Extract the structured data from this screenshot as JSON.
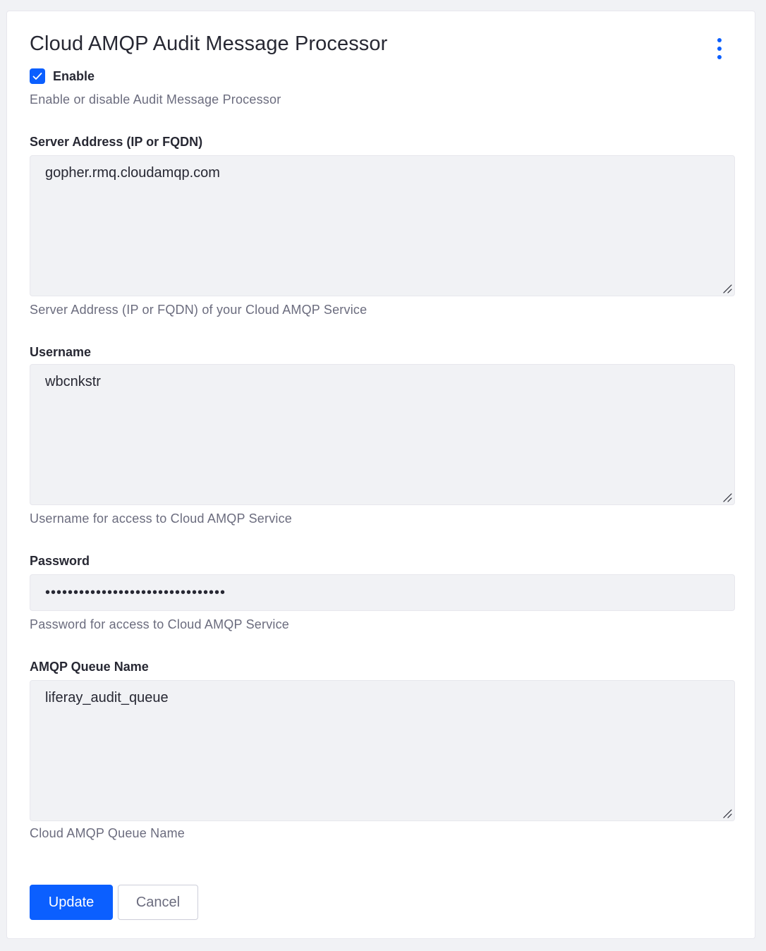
{
  "page": {
    "title": "Cloud AMQP Audit Message Processor"
  },
  "enable": {
    "label": "Enable",
    "checked": true,
    "help": "Enable or disable Audit Message Processor"
  },
  "fields": {
    "server_address": {
      "label": "Server Address (IP or FQDN)",
      "value": "gopher.rmq.cloudamqp.com",
      "help": "Server Address (IP or FQDN) of your Cloud AMQP Service"
    },
    "username": {
      "label": "Username",
      "value": "wbcnkstr",
      "help": "Username for access to Cloud AMQP Service"
    },
    "password": {
      "label": "Password",
      "value": "••••••••••••••••••••••••••••••••",
      "help": "Password for access to Cloud AMQP Service"
    },
    "queue_name": {
      "label": "AMQP Queue Name",
      "value": "liferay_audit_queue",
      "help": "Cloud AMQP Queue Name"
    }
  },
  "actions": {
    "update_label": "Update",
    "cancel_label": "Cancel"
  },
  "icons": {
    "kebab": "vertical-ellipsis-icon",
    "check": "checkmark-icon",
    "resize": "resize-handle-icon"
  },
  "colors": {
    "accent": "#0b5fff",
    "input_bg": "#f1f2f5",
    "text": "#272833",
    "muted": "#6b6c7e"
  }
}
